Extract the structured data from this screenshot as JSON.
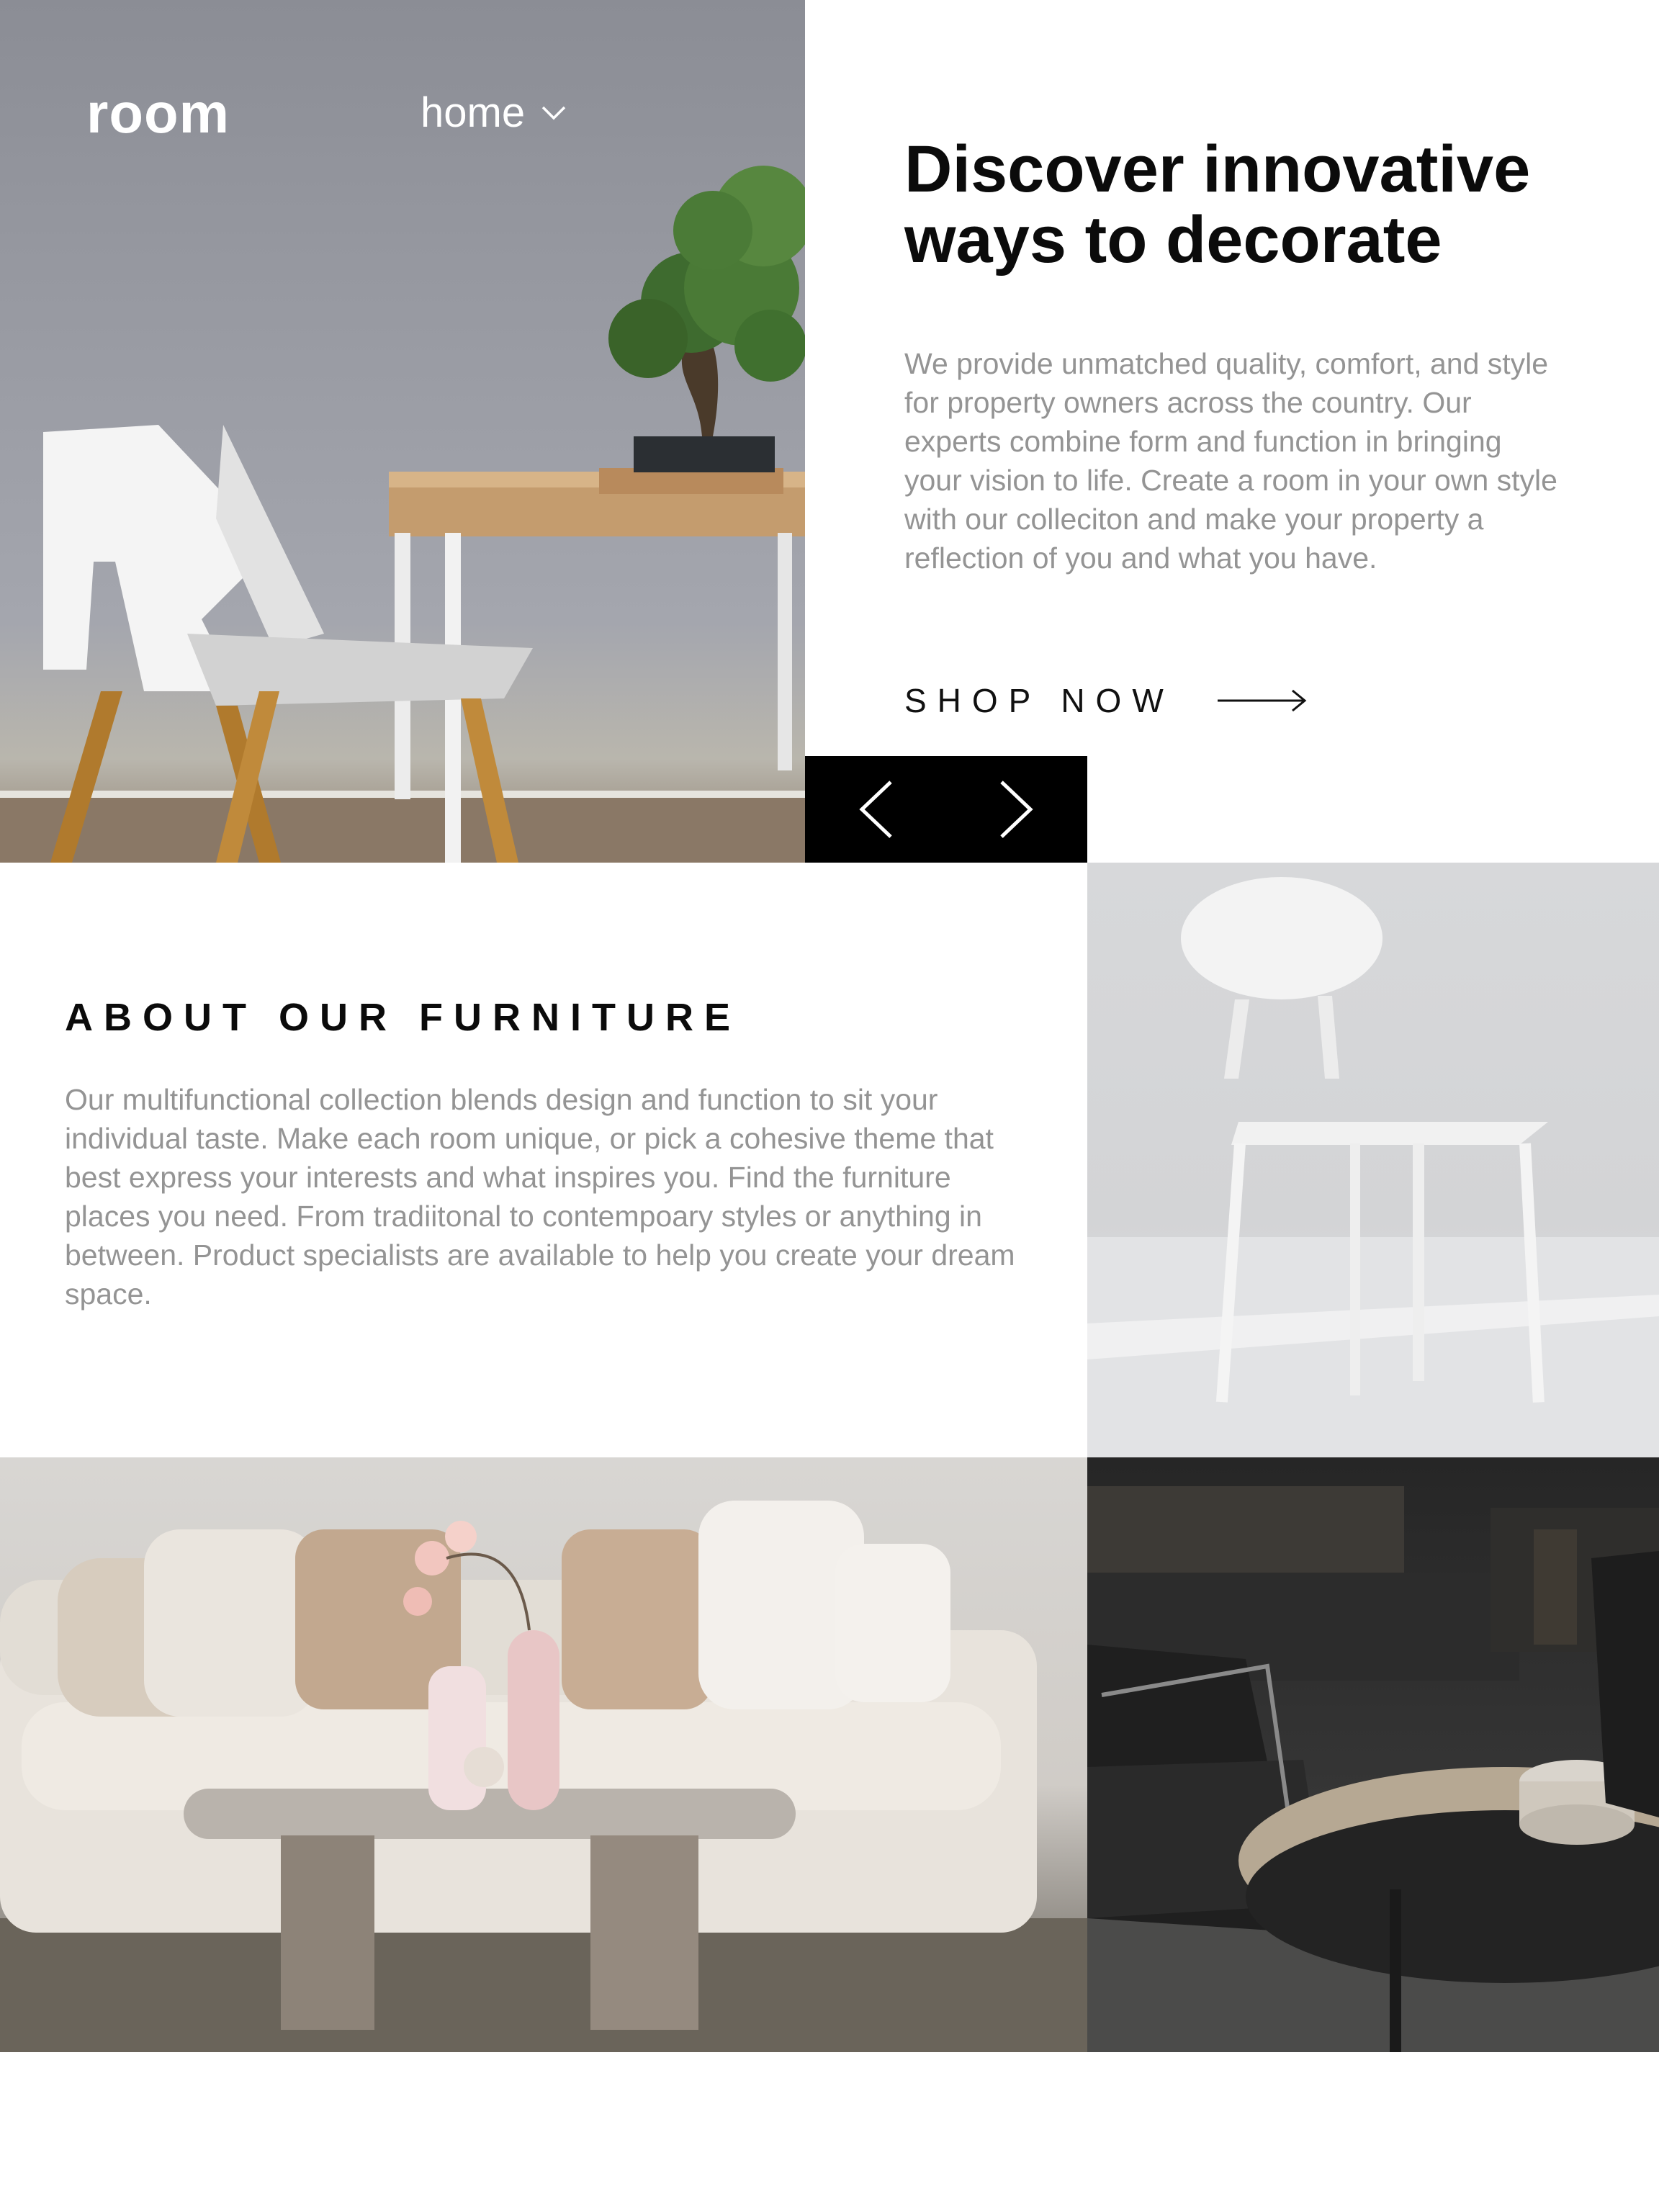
{
  "header": {
    "logo": "room",
    "nav_home_label": "home"
  },
  "hero": {
    "title": "Discover innovative ways to decorate",
    "description": "We provide unmatched quality, comfort, and style for property owners across the country. Our experts combine form and function in bringing your vision to life. Create a room in your own style with our colleciton and make your property a reflection of you and what you have.",
    "cta_label": "SHOP NOW"
  },
  "about": {
    "heading": "ABOUT OUR FURNITURE",
    "description": "Our multifunctional collection blends design and function to sit your individual taste. Make each room unique, or pick a cohesive theme that best express your interests and what inspires you. Find the furniture places you need. From tradiitonal to contempoary styles or anything in between. Product specialists are available to help you create your dream space."
  },
  "icons": {
    "nav_dropdown": "chevron-down-icon",
    "cta": "arrow-right-icon",
    "slider_prev": "chevron-left-icon",
    "slider_next": "chevron-right-icon"
  },
  "colors": {
    "text_dark": "#0b0b0b",
    "text_muted": "#949494",
    "slider_bg": "#000000",
    "page_bg": "#ffffff"
  }
}
